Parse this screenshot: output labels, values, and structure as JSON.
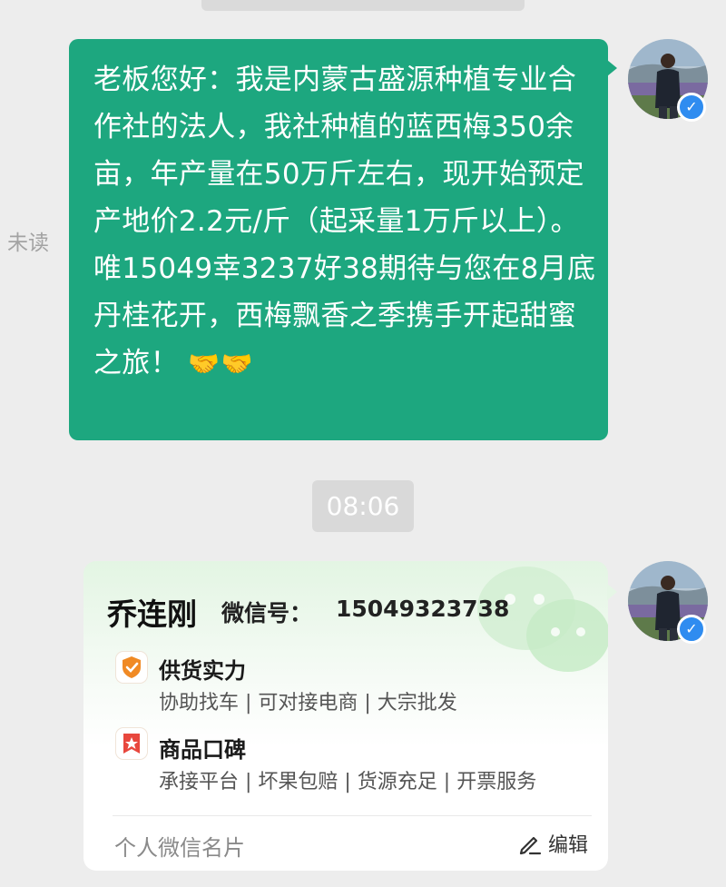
{
  "chat": {
    "unread_label": "未读",
    "message_text": "老板您好：我是内蒙古盛源种植专业合作社的法人，我社种植的蓝西梅350余亩，年产量在50万斤左右，现开始预定产地价2.2元/斤（起采量1万斤以上）。唯15049幸3237好38期待与您在8月底丹桂花开，西梅飘香之季携手开起甜蜜之旅！",
    "message_emoji": "🤝🤝",
    "timestamp": "08:06"
  },
  "card": {
    "name": "乔连刚",
    "wechat_label": "微信号：",
    "wechat_id": "15049323738",
    "features": [
      {
        "title": "供货实力",
        "desc": "协助找车 | 可对接电商 | 大宗批发",
        "icon": "shield-check-icon"
      },
      {
        "title": "商品口碑",
        "desc": "承接平台 | 坏果包赔 | 货源充足 | 开票服务",
        "icon": "star-badge-icon"
      }
    ],
    "footer_label": "个人微信名片",
    "edit_label": "编辑"
  },
  "colors": {
    "bubble": "#1da77f",
    "background": "#ededed",
    "badge_orange": "#f08a24",
    "badge_red": "#e8473d",
    "verified": "#2f8cf0"
  }
}
